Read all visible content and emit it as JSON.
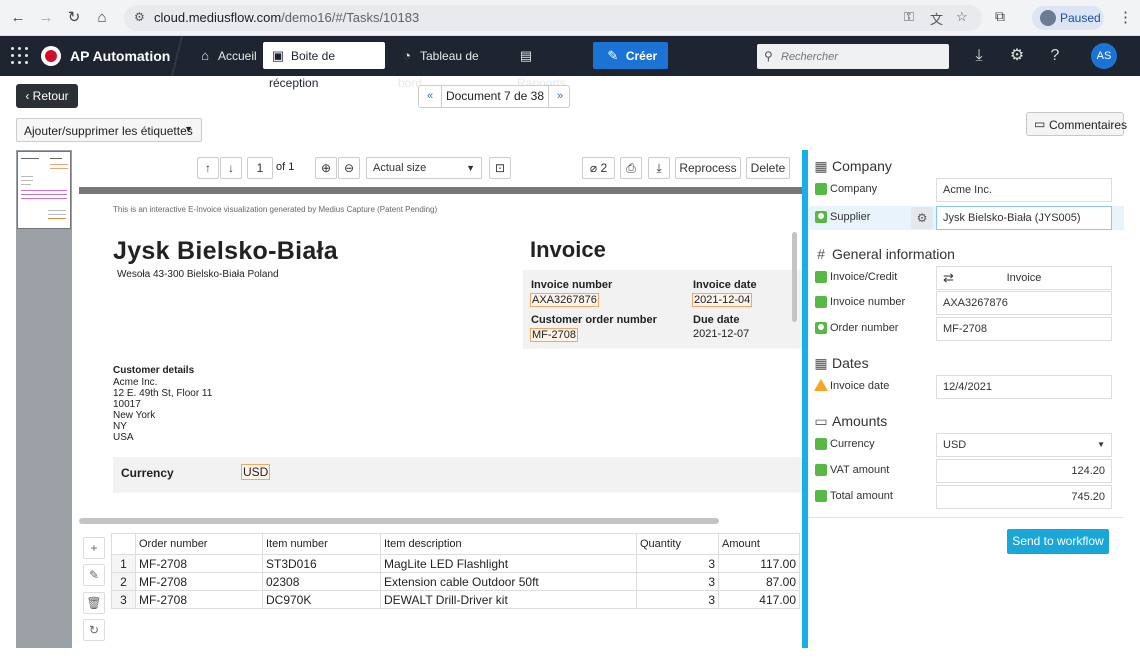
{
  "browser": {
    "url_host": "cloud.mediusflow.com",
    "url_path": "/demo16/#/Tasks/10183",
    "profile_status": "Paused"
  },
  "app": {
    "name": "AP Automation",
    "nav": [
      {
        "label": "Accueil",
        "icon": "home-icon"
      },
      {
        "label": "Boite de réception",
        "icon": "inbox-icon"
      },
      {
        "label": "Tableau de bord",
        "icon": "dashboard-icon"
      },
      {
        "label": "Rapports",
        "icon": "reports-icon"
      },
      {
        "label": "Créer",
        "icon": "create-icon"
      }
    ],
    "search_placeholder": "Rechercher",
    "user_initials": "AS"
  },
  "toolbar": {
    "back_label": "Retour",
    "document_position": "Document 7 de 38",
    "prev_label": "«",
    "next_label": "»",
    "tags_label": "Ajouter/supprimer les étiquettes",
    "comments_label": "Commentaires"
  },
  "viewer": {
    "page_current": "1",
    "page_total": "of 1",
    "zoom_option": "Actual size",
    "attachments_count": "2",
    "reprocess_label": "Reprocess",
    "delete_label": "Delete"
  },
  "invoice_doc": {
    "notice": "This is an interactive E-Invoice visualization generated by Medius Capture (Patent Pending)",
    "supplier_name": "Jysk Bielsko-Biała",
    "supplier_address": "Wesoła 43-300 Bielsko-Biała Poland",
    "title": "Invoice",
    "invoice_number_label": "Invoice number",
    "invoice_number": "AXA3267876",
    "invoice_date_label": "Invoice date",
    "invoice_date": "2021-12-04",
    "order_number_label": "Customer order number",
    "order_number": "MF-2708",
    "due_date_label": "Due date",
    "due_date": "2021-12-07",
    "customer_details_label": "Customer details",
    "customer_lines": [
      "Acme Inc.",
      "12 E. 49th St, Floor 11",
      "10017",
      "New York",
      "NY",
      "USA"
    ],
    "currency_label": "Currency",
    "currency": "USD"
  },
  "lines": {
    "headers": [
      "Order number",
      "Item number",
      "Item description",
      "Quantity",
      "Amount"
    ],
    "rows": [
      {
        "idx": "1",
        "order": "MF-2708",
        "item": "ST3D016",
        "desc": "MagLite LED Flashlight",
        "qty": "3",
        "amount": "117.00"
      },
      {
        "idx": "2",
        "order": "MF-2708",
        "item": "02308",
        "desc": "Extension cable Outdoor 50ft",
        "qty": "3",
        "amount": "87.00"
      },
      {
        "idx": "3",
        "order": "MF-2708",
        "item": "DC970K",
        "desc": "DEWALT Drill-Driver kit",
        "qty": "3",
        "amount": "417.00"
      }
    ]
  },
  "panel": {
    "company_section": "Company",
    "company_label": "Company",
    "company_value": "Acme Inc.",
    "supplier_label": "Supplier",
    "supplier_value": "Jysk Bielsko-Biała (JYS005)",
    "general_section": "General information",
    "invoice_credit_label": "Invoice/Credit",
    "invoice_credit_value": "Invoice",
    "invoice_number_label": "Invoice number",
    "invoice_number_value": "AXA3267876",
    "order_number_label": "Order number",
    "order_number_value": "MF-2708",
    "dates_section": "Dates",
    "invoice_date_label": "Invoice date",
    "invoice_date_value": "12/4/2021",
    "amounts_section": "Amounts",
    "currency_label": "Currency",
    "currency_value": "USD",
    "vat_label": "VAT amount",
    "vat_value": "124.20",
    "total_label": "Total amount",
    "total_value": "745.20",
    "send_label": "Send to workflow"
  },
  "colors": {
    "header_bg": "#1e2530",
    "accent_blue": "#1c73d6",
    "splitter": "#19aee6",
    "ok_green": "#57b846",
    "warn_orange": "#f5a623"
  }
}
